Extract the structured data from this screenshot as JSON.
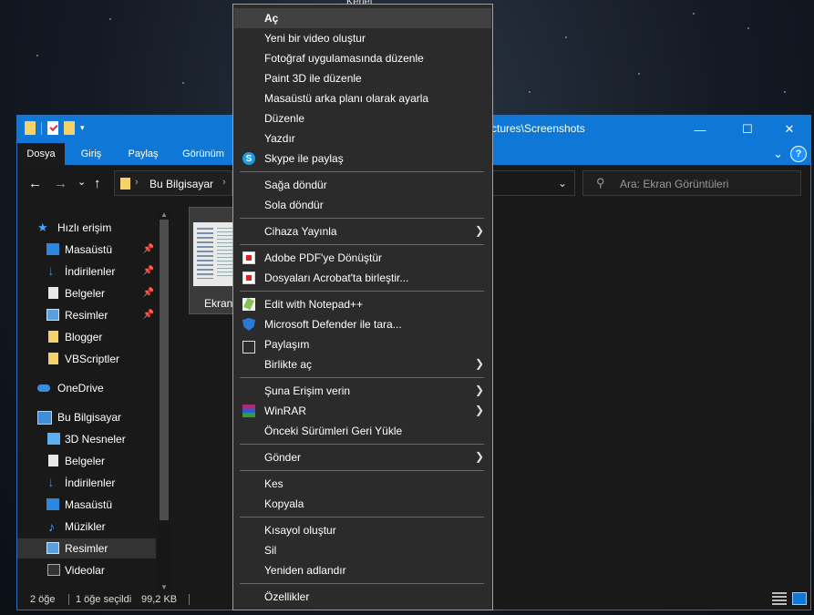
{
  "desktop": {
    "top_label": "Kenet"
  },
  "window": {
    "title": "ctures\\Screenshots",
    "controls": {
      "minimize": "—",
      "maximize": "☐",
      "close": "✕"
    }
  },
  "ribbon": {
    "tabs": [
      "Dosya",
      "Giriş",
      "Paylaş",
      "Görünüm"
    ],
    "expand": "⌄",
    "help": "?"
  },
  "nav": {
    "back": "←",
    "forward": "→",
    "dropdown": "⌄",
    "up": "↑",
    "address": "Bu Bilgisayar",
    "address_chevron": "⌄",
    "search_placeholder": "Ara: Ekran Görüntüleri"
  },
  "sidebar": {
    "items": [
      {
        "label": "Hızlı erişim",
        "icon": "star-icon",
        "pinned": false
      },
      {
        "label": "Masaüstü",
        "icon": "desktop-icon",
        "pinned": true
      },
      {
        "label": "İndirilenler",
        "icon": "download-icon",
        "pinned": true
      },
      {
        "label": "Belgeler",
        "icon": "document-icon",
        "pinned": true
      },
      {
        "label": "Resimler",
        "icon": "pictures-icon",
        "pinned": true
      },
      {
        "label": "Blogger",
        "icon": "folder-icon",
        "pinned": false
      },
      {
        "label": "VBScriptler",
        "icon": "folder-icon",
        "pinned": false
      },
      {
        "label": "OneDrive",
        "icon": "cloud-icon",
        "pinned": false
      },
      {
        "label": "Bu Bilgisayar",
        "icon": "computer-icon",
        "pinned": false
      },
      {
        "label": "3D Nesneler",
        "icon": "cube-icon",
        "pinned": false
      },
      {
        "label": "Belgeler",
        "icon": "document-icon",
        "pinned": false
      },
      {
        "label": "İndirilenler",
        "icon": "download-icon",
        "pinned": false
      },
      {
        "label": "Masaüstü",
        "icon": "desktop-icon",
        "pinned": false
      },
      {
        "label": "Müzikler",
        "icon": "music-icon",
        "pinned": false
      },
      {
        "label": "Resimler",
        "icon": "pictures-icon",
        "pinned": false,
        "selected": true
      },
      {
        "label": "Videolar",
        "icon": "video-icon",
        "pinned": false
      }
    ]
  },
  "content": {
    "file_caption": "Ekran"
  },
  "status": {
    "item_count": "2 öğe",
    "selected": "1 öğe seçildi",
    "size": "99,2 KB"
  },
  "context_menu": {
    "items": [
      {
        "label": "Aç",
        "bold": true,
        "highlight": true
      },
      {
        "label": "Yeni bir video oluştur"
      },
      {
        "label": "Fotoğraf uygulamasında düzenle"
      },
      {
        "label": "Paint 3D ile düzenle"
      },
      {
        "label": "Masaüstü arka planı olarak ayarla"
      },
      {
        "label": "Düzenle"
      },
      {
        "label": "Yazdır"
      },
      {
        "label": "Skype ile paylaş",
        "icon": "skype-icon"
      },
      {
        "label": "Sağa döndür"
      },
      {
        "label": "Sola döndür"
      },
      {
        "label": "Cihaza Yayınla",
        "submenu": true
      },
      {
        "label": "Adobe PDF'ye Dönüştür",
        "icon": "pdf-icon"
      },
      {
        "label": "Dosyaları Acrobat'ta birleştir...",
        "icon": "acrobat-icon"
      },
      {
        "label": "Edit with Notepad++",
        "icon": "notepadpp-icon"
      },
      {
        "label": "Microsoft Defender ile tara...",
        "icon": "defender-icon"
      },
      {
        "label": "Paylaşım",
        "icon": "share-icon"
      },
      {
        "label": "Birlikte aç",
        "submenu": true
      },
      {
        "label": "Şuna Erişim verin",
        "submenu": true
      },
      {
        "label": "WinRAR",
        "icon": "winrar-icon",
        "submenu": true
      },
      {
        "label": "Önceki Sürümleri Geri Yükle"
      },
      {
        "label": "Gönder",
        "submenu": true
      },
      {
        "label": "Kes"
      },
      {
        "label": "Kopyala"
      },
      {
        "label": "Kısayol oluştur"
      },
      {
        "label": "Sil"
      },
      {
        "label": "Yeniden adlandır"
      },
      {
        "label": "Özellikler"
      }
    ],
    "submenu_arrow": "❯"
  }
}
